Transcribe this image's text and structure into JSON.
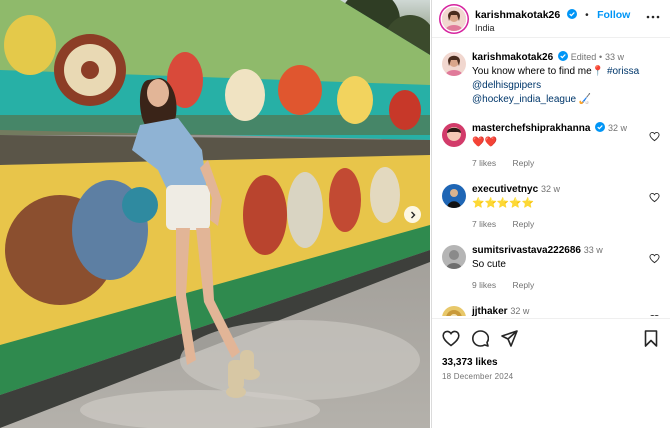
{
  "post": {
    "username": "karishmakotak26",
    "follow_label": "Follow",
    "location": "India",
    "caption": {
      "username": "karishmakotak26",
      "edited": "Edited",
      "age": "33 w",
      "text": "You know where to find me",
      "pin_emoji": "📍",
      "hashtag": "#orissa",
      "mention1": "@delhisgpipers",
      "mention2": "@hockey_india_league",
      "trail_emoji": "🏑"
    },
    "likes": "33,373 likes",
    "date": "18 December 2024"
  },
  "comments": [
    {
      "username": "masterchefshiprakhanna",
      "verified": true,
      "age": "32 w",
      "text": "❤️❤️",
      "likes": "7 likes",
      "reply": "Reply"
    },
    {
      "username": "executivetnyc",
      "verified": false,
      "age": "32 w",
      "text": "⭐⭐⭐⭐⭐",
      "likes": "7 likes",
      "reply": "Reply"
    },
    {
      "username": "sumitsrivastava222686",
      "verified": false,
      "age": "33 w",
      "text": "So cute",
      "likes": "9 likes",
      "reply": "Reply"
    },
    {
      "username": "jjthaker",
      "verified": false,
      "age": "32 w",
      "text": "❤️🔥❤️🔥",
      "likes": "",
      "reply": ""
    }
  ],
  "colors": {
    "accent": "#0095f6",
    "verified": "#0095f6",
    "meta_text": "#737373",
    "link": "#00376b"
  },
  "icons": [
    "more-horizontal-icon",
    "verified-badge-icon",
    "heart-icon",
    "comment-icon",
    "share-icon",
    "bookmark-icon",
    "chevron-right-icon"
  ]
}
